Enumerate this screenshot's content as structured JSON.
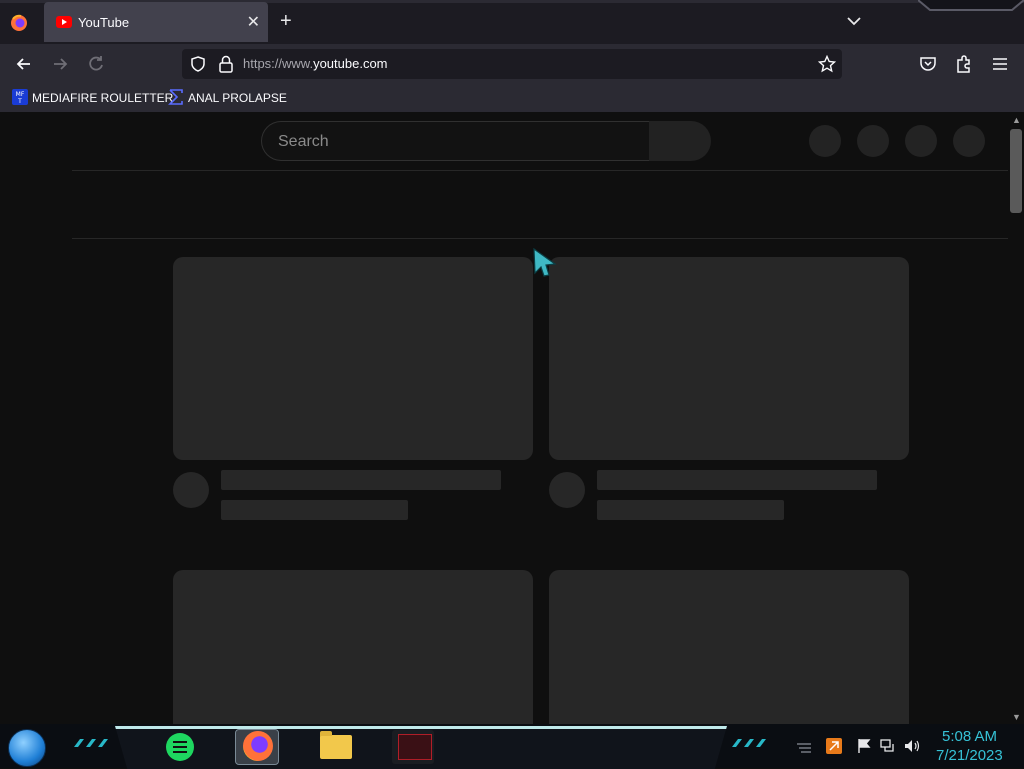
{
  "browser": {
    "tab": {
      "title": "YouTube"
    },
    "url": {
      "prefix": "https://www.",
      "domain": "youtube.com"
    },
    "bookmarks": [
      {
        "label": "MEDIAFIRE ROULETTER",
        "icon": "mediafire-icon"
      },
      {
        "label": "ANAL PROLAPSE",
        "icon": "sigma-icon"
      }
    ]
  },
  "youtube": {
    "search_placeholder": "Search"
  },
  "taskbar": {
    "apps": [
      "spotify",
      "firefox",
      "file-explorer",
      "game"
    ],
    "clock": {
      "time": "5:08 AM",
      "date": "7/21/2023"
    }
  },
  "colors": {
    "accent": "#36c2d6",
    "youtube_red": "#ff0000"
  }
}
